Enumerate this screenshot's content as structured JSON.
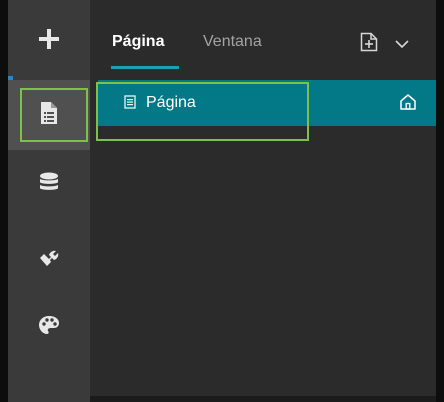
{
  "sidebar": {
    "items": [
      {
        "name": "add",
        "icon": "plus-icon",
        "active": false
      },
      {
        "name": "pages",
        "icon": "page-list-icon",
        "active": true
      },
      {
        "name": "data",
        "icon": "database-icon",
        "active": false
      },
      {
        "name": "tools",
        "icon": "wrench-icon",
        "active": false
      },
      {
        "name": "theme",
        "icon": "palette-icon",
        "active": false
      }
    ]
  },
  "panel": {
    "tabs": [
      {
        "label": "Página",
        "active": true
      },
      {
        "label": "Ventana",
        "active": false
      }
    ],
    "header_icons": [
      "add-page-icon",
      "chevron-down-icon"
    ],
    "pages": [
      {
        "label": "Página",
        "icon": "document-icon",
        "is_home": true,
        "selected": true
      }
    ]
  },
  "colors": {
    "accent": "#1aa1b8",
    "selection": "#037987",
    "focus_outline": "#7cc24a",
    "rail_indicator": "#2b86c5"
  }
}
